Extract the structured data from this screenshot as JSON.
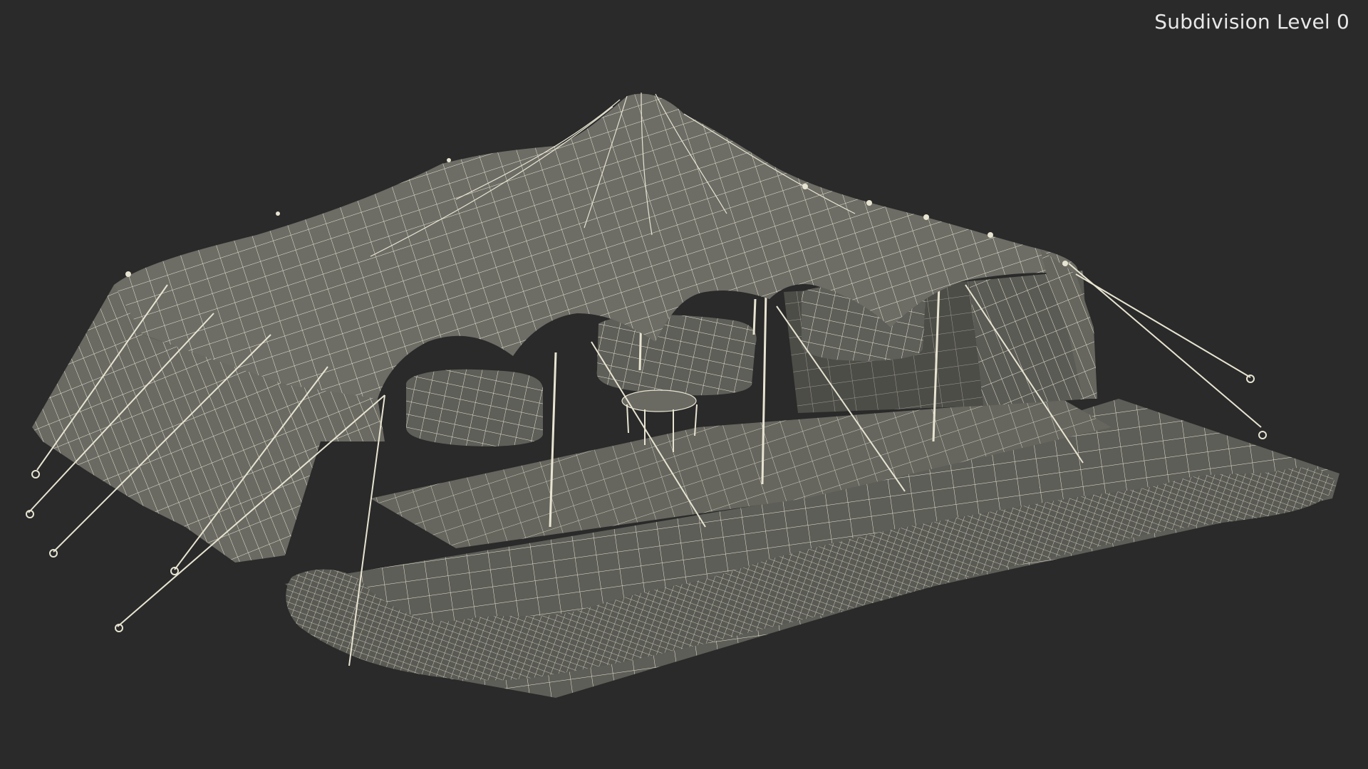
{
  "viewport": {
    "overlay_label": "Subdivision Level 0",
    "background_color": "#2a2a2a",
    "mesh_fill_color": "#6d6d66",
    "mesh_dark_fill_color": "#55554f",
    "wire_color": "#e8e4d2"
  }
}
